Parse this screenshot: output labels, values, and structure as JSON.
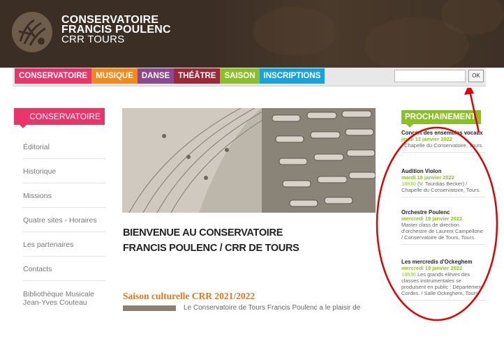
{
  "header": {
    "brand_line1": "CONSERVATOIRE",
    "brand_line2": "FRANCIS POULENC",
    "brand_line3": "CRR TOURS"
  },
  "nav": {
    "items": [
      {
        "label": "CONSERVATOIRE",
        "color": "#e8356b"
      },
      {
        "label": "MUSIQUE",
        "color": "#f08a1c"
      },
      {
        "label": "DANSE",
        "color": "#8c4a8c"
      },
      {
        "label": "THÉÂTRE",
        "color": "#9a2a3a"
      },
      {
        "label": "SAISON",
        "color": "#8bbf2a"
      },
      {
        "label": "INSCRIPTIONS",
        "color": "#1aa3d9"
      }
    ],
    "search_value": "",
    "ok_label": "OK"
  },
  "sidebar": {
    "heading": "CONSERVATOIRE",
    "items": [
      {
        "label": "Éditorial"
      },
      {
        "label": "Historique"
      },
      {
        "label": "Missions"
      },
      {
        "label": "Quatre sites - Horaires"
      },
      {
        "label": "Les partenaires"
      },
      {
        "label": "Contacts"
      },
      {
        "label": "Bibliothèque Musicale Jean-Yves Couteau"
      }
    ]
  },
  "main": {
    "welcome_line1": "BIENVENUE AU CONSERVATOIRE",
    "welcome_line2": "FRANCIS POULENC / CRR DE TOURS",
    "saison_title": "Saison culturelle CRR 2021/2022",
    "snippet": "Le Conservatoire de Tours Francis Poulenc a le plaisir de"
  },
  "prochainement": {
    "heading": "PROCHAINEMENT",
    "events": [
      {
        "title": "Concert des ensembles vocaux",
        "date": "jeudi 13 janvier 2022",
        "hour": "",
        "info": "/ Chapelle du Conservatoire, Tours."
      },
      {
        "title": "Audition Violon",
        "date": "mardi 18 janvier 2022",
        "hour": "18h30",
        "info": "(V. Tourdias Becker) / Chapelle du Conservatoire, Tours."
      },
      {
        "title": "Orchestre Poulenc",
        "date": "mercredi 19 janvier 2022",
        "hour": "",
        "info": "Master class de direction d'orchestre de Laurent Campellone / Conservatoire de Tours, Tours."
      },
      {
        "title": "Les mercredis d'Ockeghem",
        "date": "mercredi 19 janvier 2022",
        "hour": "18h30",
        "info": "Les grands élèves des classes instrumentales se produisent en public : Département Cordes. / Salle Ockeghem, Tours."
      }
    ]
  },
  "colors": {
    "annotation": "#e00000"
  }
}
